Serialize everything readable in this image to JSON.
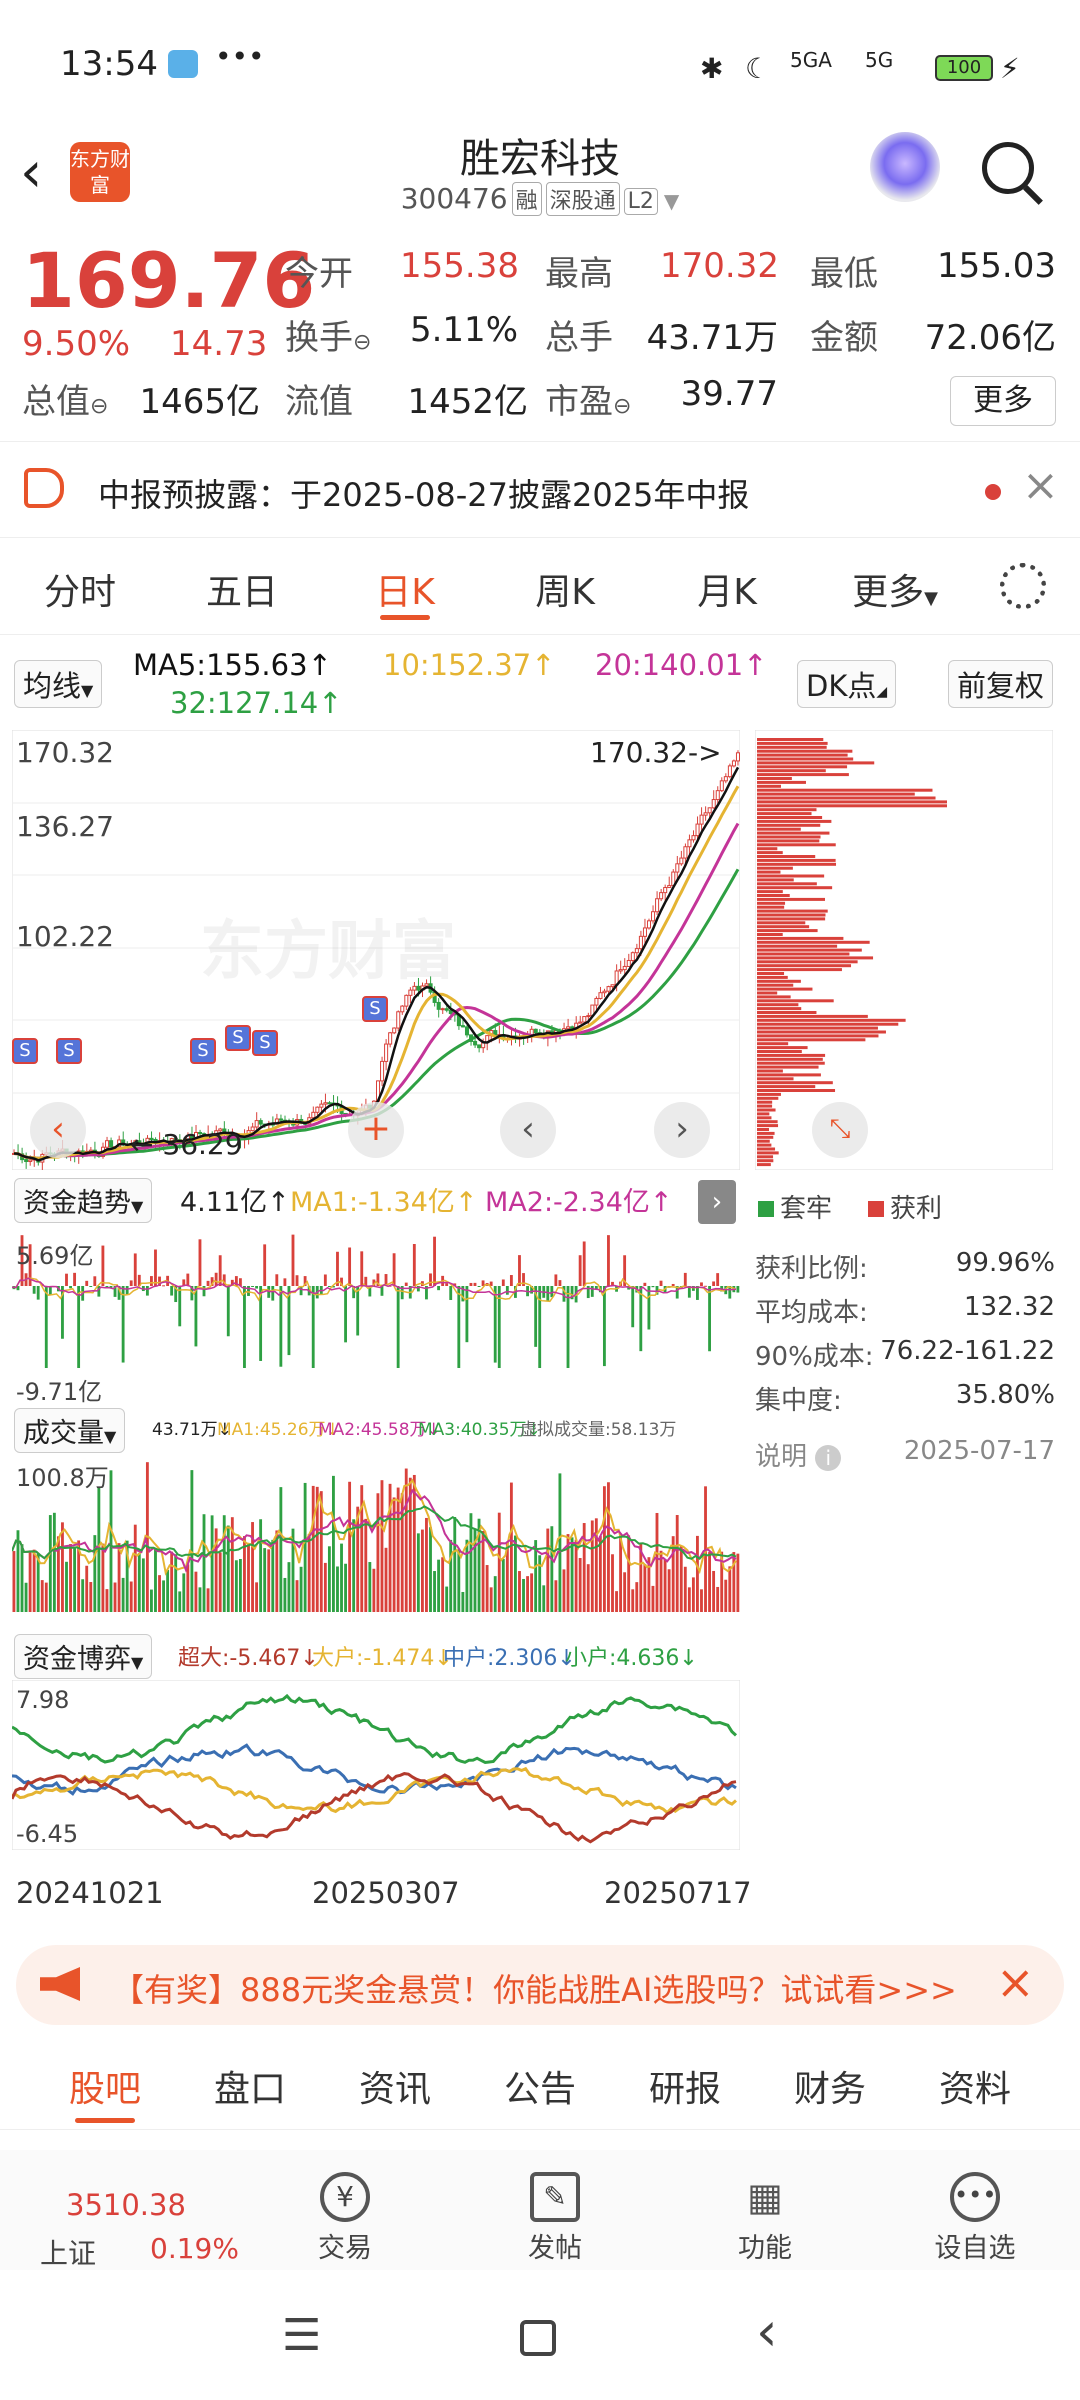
{
  "status": {
    "time": "13:54",
    "battery": "100",
    "net1": "5GA",
    "net2": "5G"
  },
  "header": {
    "app_logo": "东方财富",
    "title": "胜宏科技",
    "code": "300476",
    "tags": [
      "融",
      "深股通",
      "L2"
    ]
  },
  "quote": {
    "price": "169.76",
    "change_pct": "9.50%",
    "change": "14.73",
    "fields": [
      {
        "label": "今开",
        "value": "155.38",
        "color": "#d9413b"
      },
      {
        "label": "最高",
        "value": "170.32",
        "color": "#d9413b"
      },
      {
        "label": "最低",
        "value": "155.03",
        "color": "#222"
      },
      {
        "label": "换手",
        "value": "5.11%",
        "color": "#222"
      },
      {
        "label": "总手",
        "value": "43.71万",
        "color": "#222"
      },
      {
        "label": "金额",
        "value": "72.06亿",
        "color": "#222"
      },
      {
        "label": "总值",
        "value": "1465亿",
        "color": "#222"
      },
      {
        "label": "流值",
        "value": "1452亿",
        "color": "#222"
      },
      {
        "label": "市盈",
        "value": "39.77",
        "color": "#222"
      }
    ],
    "more": "更多"
  },
  "notice": {
    "text": "中报预披露：于2025-08-27披露2025年中报"
  },
  "tabs": [
    "分时",
    "五日",
    "日K",
    "周K",
    "月K",
    "更多"
  ],
  "kline": {
    "ma_selector": "均线",
    "ma5": "MA5:155.63",
    "ma10": "10:152.37",
    "ma20": "20:140.01",
    "ma32": "32:127.14",
    "dk": "DK点",
    "fq": "前复权",
    "y_labels": [
      "170.32",
      "136.27",
      "102.22"
    ],
    "max_marker": "170.32->",
    "min_marker": "36.29",
    "watermark": "东方财富"
  },
  "fund_trend": {
    "selector": "资金趋势",
    "val": "4.11亿",
    "ma1": "MA1:-1.34亿",
    "ma2": "MA2:-2.34亿",
    "ymax": "5.69亿",
    "ymin": "-9.71亿"
  },
  "volume": {
    "selector": "成交量",
    "val": "43.71万",
    "ma1": "MA1:45.26万",
    "ma2": "MA2:45.58万",
    "ma3": "MA3:40.35万",
    "virtual": "虚拟成交量:58.13万",
    "ymax": "100.8万"
  },
  "fund_game": {
    "selector": "资金博弈",
    "super": "超大:-5.467",
    "big": "大户:-1.474",
    "mid": "中户:2.306",
    "small": "小户:4.636",
    "ymax": "7.98",
    "ymin": "-6.45"
  },
  "dates": [
    "20241021",
    "20250307",
    "20250717"
  ],
  "cost": {
    "legend_trapped": "套牢",
    "legend_profit": "获利",
    "rows": [
      {
        "label": "获利比例:",
        "value": "99.96%"
      },
      {
        "label": "平均成本:",
        "value": "132.32"
      },
      {
        "label": "90%成本:",
        "value": "76.22-161.22"
      },
      {
        "label": "集中度:",
        "value": "35.80%"
      }
    ],
    "note": "说明",
    "date": "2025-07-17"
  },
  "banner": {
    "text": "【有奖】888元奖金悬赏！你能战胜AI选股吗？试试看>>>"
  },
  "bottom_tabs": [
    "股吧",
    "盘口",
    "资讯",
    "公告",
    "研报",
    "财务",
    "资料"
  ],
  "footer": {
    "index_name": "上证",
    "index_value": "3510.38",
    "index_change": "0.19%",
    "items": [
      "交易",
      "发帖",
      "功能",
      "设自选"
    ]
  },
  "colors": {
    "up": "#d9413b",
    "down": "#2ea043",
    "accent": "#e8542a"
  }
}
